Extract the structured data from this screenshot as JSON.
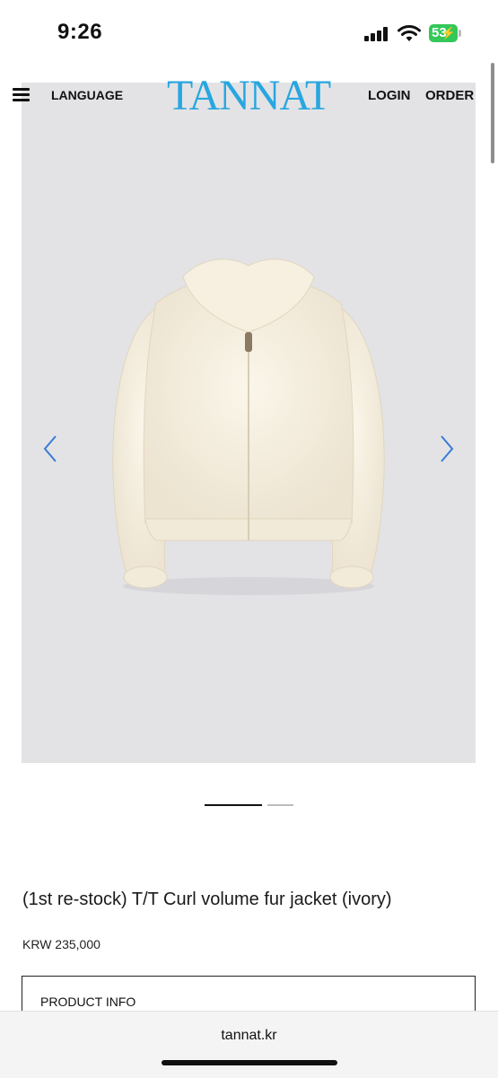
{
  "status": {
    "time": "9:26",
    "battery": "53"
  },
  "header": {
    "menu_icon": "hamburger-menu-icon",
    "language": "LANGUAGE",
    "logo": "TANNAT",
    "login": "LOGIN",
    "order": "ORDER",
    "logo_color": "#29a6df"
  },
  "gallery": {
    "background": "#e3e3e6",
    "prev_icon": "chevron-left-icon",
    "next_icon": "chevron-right-icon",
    "arrow_color": "#3a7bd5",
    "slides_total": 2,
    "active_slide": 1
  },
  "product": {
    "title": "(1st re-stock) T/T Curl volume fur jacket (ivory)",
    "price": "KRW 235,000",
    "info_label": "PRODUCT INFO"
  },
  "browser": {
    "url": "tannat.kr"
  }
}
